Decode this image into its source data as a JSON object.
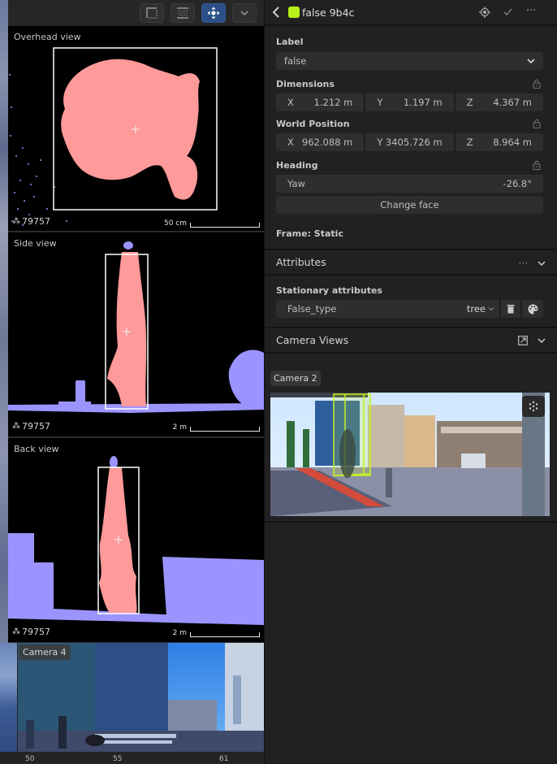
{
  "toolbar": {
    "buttons": [
      {
        "name": "crop-mode",
        "icon": "corner-frame-icon",
        "active": false
      },
      {
        "name": "grid-mode",
        "icon": "grid-lines-icon",
        "active": false
      },
      {
        "name": "move-mode",
        "icon": "move-arrows-icon",
        "active": true
      },
      {
        "name": "more",
        "icon": "chevron-down-icon",
        "active": false
      }
    ]
  },
  "views": [
    {
      "title": "Overhead view",
      "point_count": "79757",
      "scale": "50 cm"
    },
    {
      "title": "Side view",
      "point_count": "79757",
      "scale": "2 m"
    },
    {
      "title": "Back view",
      "point_count": "79757",
      "scale": "2 m"
    }
  ],
  "camera_left": {
    "label": "Camera 4"
  },
  "timeline": {
    "ticks": [
      "50",
      "55",
      "61"
    ]
  },
  "inspector": {
    "title": "false 9b4c",
    "swatch_color": "#b8f01a",
    "label_section": {
      "heading": "Label",
      "value": "false"
    },
    "dimensions": {
      "heading": "Dimensions",
      "x_axis": "X",
      "x": "1.212 m",
      "y_axis": "Y",
      "y": "1.197 m",
      "z_axis": "Z",
      "z": "4.367 m"
    },
    "world_position": {
      "heading": "World Position",
      "x_axis": "X",
      "x": "962.088 m",
      "y_axis": "Y",
      "y": "3405.726 m",
      "z_axis": "Z",
      "z": "8.964 m"
    },
    "heading": {
      "heading": "Heading",
      "yaw_label": "Yaw",
      "yaw": "-26.8°",
      "change_face": "Change face"
    },
    "frame": "Frame: Static",
    "attributes": {
      "heading": "Attributes",
      "stationary_heading": "Stationary attributes",
      "items": [
        {
          "name": "False_type",
          "value": "tree"
        }
      ]
    },
    "camera_views": {
      "heading": "Camera Views",
      "camera_label": "Camera 2"
    }
  },
  "colors": {
    "object_points": "#ff9a9a",
    "environment_points": "#9b94ff",
    "cuboid": "#c6f51e",
    "active_tool": "#2b4f86"
  }
}
